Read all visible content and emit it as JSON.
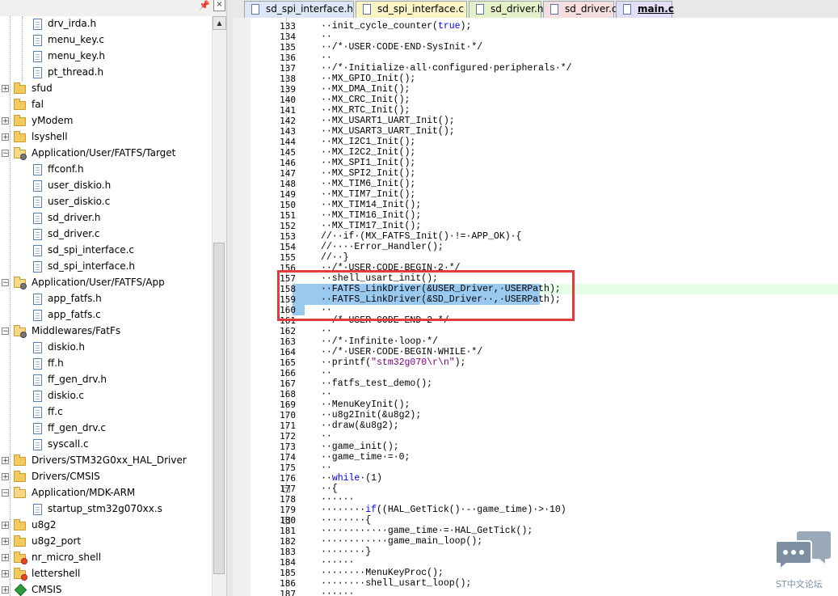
{
  "project_tree": {
    "items": [
      {
        "label": "drv_irda.h",
        "kind": "file",
        "level": 2
      },
      {
        "label": "menu_key.c",
        "kind": "file",
        "level": 2
      },
      {
        "label": "menu_key.h",
        "kind": "file",
        "level": 2
      },
      {
        "label": "pt_thread.h",
        "kind": "file",
        "level": 2
      },
      {
        "label": "sfud",
        "kind": "folder",
        "level": 0,
        "expander": "+"
      },
      {
        "label": "fal",
        "kind": "folder",
        "level": 0,
        "expander": ""
      },
      {
        "label": "yModem",
        "kind": "folder",
        "level": 0,
        "expander": "+"
      },
      {
        "label": "lsyshell",
        "kind": "folder",
        "level": 0,
        "expander": "+"
      },
      {
        "label": "Application/User/FATFS/Target",
        "kind": "folder-open-gear",
        "level": 0,
        "expander": "-"
      },
      {
        "label": "ffconf.h",
        "kind": "file",
        "level": 1
      },
      {
        "label": "user_diskio.h",
        "kind": "file",
        "level": 1
      },
      {
        "label": "user_diskio.c",
        "kind": "file",
        "level": 1
      },
      {
        "label": "sd_driver.h",
        "kind": "file",
        "level": 1
      },
      {
        "label": "sd_driver.c",
        "kind": "file",
        "level": 1
      },
      {
        "label": "sd_spi_interface.c",
        "kind": "file",
        "level": 1
      },
      {
        "label": "sd_spi_interface.h",
        "kind": "file",
        "level": 1
      },
      {
        "label": "Application/User/FATFS/App",
        "kind": "folder-open-gear",
        "level": 0,
        "expander": "-"
      },
      {
        "label": "app_fatfs.h",
        "kind": "file",
        "level": 1
      },
      {
        "label": "app_fatfs.c",
        "kind": "file",
        "level": 1
      },
      {
        "label": "Middlewares/FatFs",
        "kind": "folder-open-gear",
        "level": 0,
        "expander": "-"
      },
      {
        "label": "diskio.h",
        "kind": "file",
        "level": 1
      },
      {
        "label": "ff.h",
        "kind": "file",
        "level": 1
      },
      {
        "label": "ff_gen_drv.h",
        "kind": "file",
        "level": 1
      },
      {
        "label": "diskio.c",
        "kind": "file",
        "level": 1
      },
      {
        "label": "ff.c",
        "kind": "file",
        "level": 1
      },
      {
        "label": "ff_gen_drv.c",
        "kind": "file",
        "level": 1
      },
      {
        "label": "syscall.c",
        "kind": "file",
        "level": 1
      },
      {
        "label": "Drivers/STM32G0xx_HAL_Driver",
        "kind": "folder",
        "level": 0,
        "expander": "+"
      },
      {
        "label": "Drivers/CMSIS",
        "kind": "folder",
        "level": 0,
        "expander": "+"
      },
      {
        "label": "Application/MDK-ARM",
        "kind": "folder-open",
        "level": 0,
        "expander": "-"
      },
      {
        "label": "startup_stm32g070xx.s",
        "kind": "file",
        "level": 1
      },
      {
        "label": "u8g2",
        "kind": "folder",
        "level": 0,
        "expander": "+"
      },
      {
        "label": "u8g2_port",
        "kind": "folder",
        "level": 0,
        "expander": "+"
      },
      {
        "label": "nr_micro_shell",
        "kind": "folder-lib",
        "level": 0,
        "expander": "+"
      },
      {
        "label": "lettershell",
        "kind": "folder-lib",
        "level": 0,
        "expander": "+"
      },
      {
        "label": "CMSIS",
        "kind": "diamond",
        "level": 0,
        "expander": "+"
      }
    ],
    "header_close": "×"
  },
  "tabs": [
    {
      "label": "sd_spi_interface.h",
      "color": "#dce6f4",
      "active": false
    },
    {
      "label": "sd_spi_interface.c",
      "color": "#fbf3c4",
      "active": false
    },
    {
      "label": "sd_driver.h",
      "color": "#e6f0c8",
      "active": false
    },
    {
      "label": "sd_driver.c",
      "color": "#f6dede",
      "active": false
    },
    {
      "label": "main.c",
      "color": "#e3ddf5",
      "active": true
    }
  ],
  "code_lines": [
    {
      "n": "133",
      "t": "··init_cycle_counter(true);"
    },
    {
      "n": "134",
      "t": "··"
    },
    {
      "n": "135",
      "t": "··/*·USER·CODE·END·SysInit·*/",
      "c": true
    },
    {
      "n": "136",
      "t": "··"
    },
    {
      "n": "137",
      "t": "··/*·Initialize·all·configured·peripherals·*/",
      "c": true
    },
    {
      "n": "138",
      "t": "··MX_GPIO_Init();"
    },
    {
      "n": "139",
      "t": "··MX_DMA_Init();"
    },
    {
      "n": "140",
      "t": "··MX_CRC_Init();"
    },
    {
      "n": "141",
      "t": "··MX_RTC_Init();"
    },
    {
      "n": "142",
      "t": "··MX_USART1_UART_Init();"
    },
    {
      "n": "143",
      "t": "··MX_USART3_UART_Init();"
    },
    {
      "n": "144",
      "t": "··MX_I2C1_Init();"
    },
    {
      "n": "145",
      "t": "··MX_I2C2_Init();"
    },
    {
      "n": "146",
      "t": "··MX_SPI1_Init();"
    },
    {
      "n": "147",
      "t": "··MX_SPI2_Init();"
    },
    {
      "n": "148",
      "t": "··MX_TIM6_Init();"
    },
    {
      "n": "149",
      "t": "··MX_TIM7_Init();"
    },
    {
      "n": "150",
      "t": "··MX_TIM14_Init();"
    },
    {
      "n": "151",
      "t": "··MX_TIM16_Init();"
    },
    {
      "n": "152",
      "t": "··MX_TIM17_Init();"
    },
    {
      "n": "153",
      "t": "//··if·(MX_FATFS_Init()·!=·APP_OK)·{",
      "c": true
    },
    {
      "n": "154",
      "t": "//····Error_Handler();",
      "c": true
    },
    {
      "n": "155",
      "t": "//··}",
      "c": true
    },
    {
      "n": "156",
      "t": "··/*·USER·CODE·BEGIN·2·*/",
      "c": true
    },
    {
      "n": "157",
      "t": "··shell_usart_init();"
    },
    {
      "n": "158",
      "t": "··FATFS_LinkDriver(&USER_Driver,·USERPath);",
      "sel": true
    },
    {
      "n": "159",
      "t": "··FATFS_LinkDriver(&SD_Driver··,·USERPath);",
      "sel": true
    },
    {
      "n": "160",
      "t": "··",
      "sel": true
    },
    {
      "n": "161",
      "t": "··/*·USER·CODE·END·2·*/",
      "c": true
    },
    {
      "n": "162",
      "t": "··"
    },
    {
      "n": "163",
      "t": "··/*·Infinite·loop·*/",
      "c": true
    },
    {
      "n": "164",
      "t": "··/*·USER·CODE·BEGIN·WHILE·*/",
      "c": true
    },
    {
      "n": "165",
      "t": "··printf(\"stm32g070\\r\\n\");",
      "s": true
    },
    {
      "n": "166",
      "t": "··"
    },
    {
      "n": "167",
      "t": "··fatfs_test_demo();"
    },
    {
      "n": "168",
      "t": "··"
    },
    {
      "n": "169",
      "t": "··MenuKeyInit();"
    },
    {
      "n": "170",
      "t": "··u8g2Init(&u8g2);"
    },
    {
      "n": "171",
      "t": "··draw(&u8g2);"
    },
    {
      "n": "172",
      "t": "··"
    },
    {
      "n": "173",
      "t": "··game_init();"
    },
    {
      "n": "174",
      "t": "··game_time·=·0;"
    },
    {
      "n": "175",
      "t": "··"
    },
    {
      "n": "176",
      "t": "··while·(1)",
      "k": true
    },
    {
      "n": "177",
      "t": "··{",
      "fold": "-"
    },
    {
      "n": "178",
      "t": "······"
    },
    {
      "n": "179",
      "t": "········if((HAL_GetTick()·-·game_time)·>·10)",
      "k2": true
    },
    {
      "n": "180",
      "t": "········{",
      "fold": "-"
    },
    {
      "n": "181",
      "t": "············game_time·=·HAL_GetTick();"
    },
    {
      "n": "182",
      "t": "············game_main_loop();"
    },
    {
      "n": "183",
      "t": "········}"
    },
    {
      "n": "184",
      "t": "······"
    },
    {
      "n": "185",
      "t": "········MenuKeyProc();"
    },
    {
      "n": "186",
      "t": "········shell_usart_loop();"
    },
    {
      "n": "187",
      "t": "······"
    }
  ],
  "watermark": {
    "text": "ST中文论坛"
  },
  "colors": {
    "selection": "#99c9ef",
    "current_line": "#e6ffe6",
    "highlight_box": "#e03c3c",
    "comment": "#008000",
    "keyword": "#0000ff"
  }
}
